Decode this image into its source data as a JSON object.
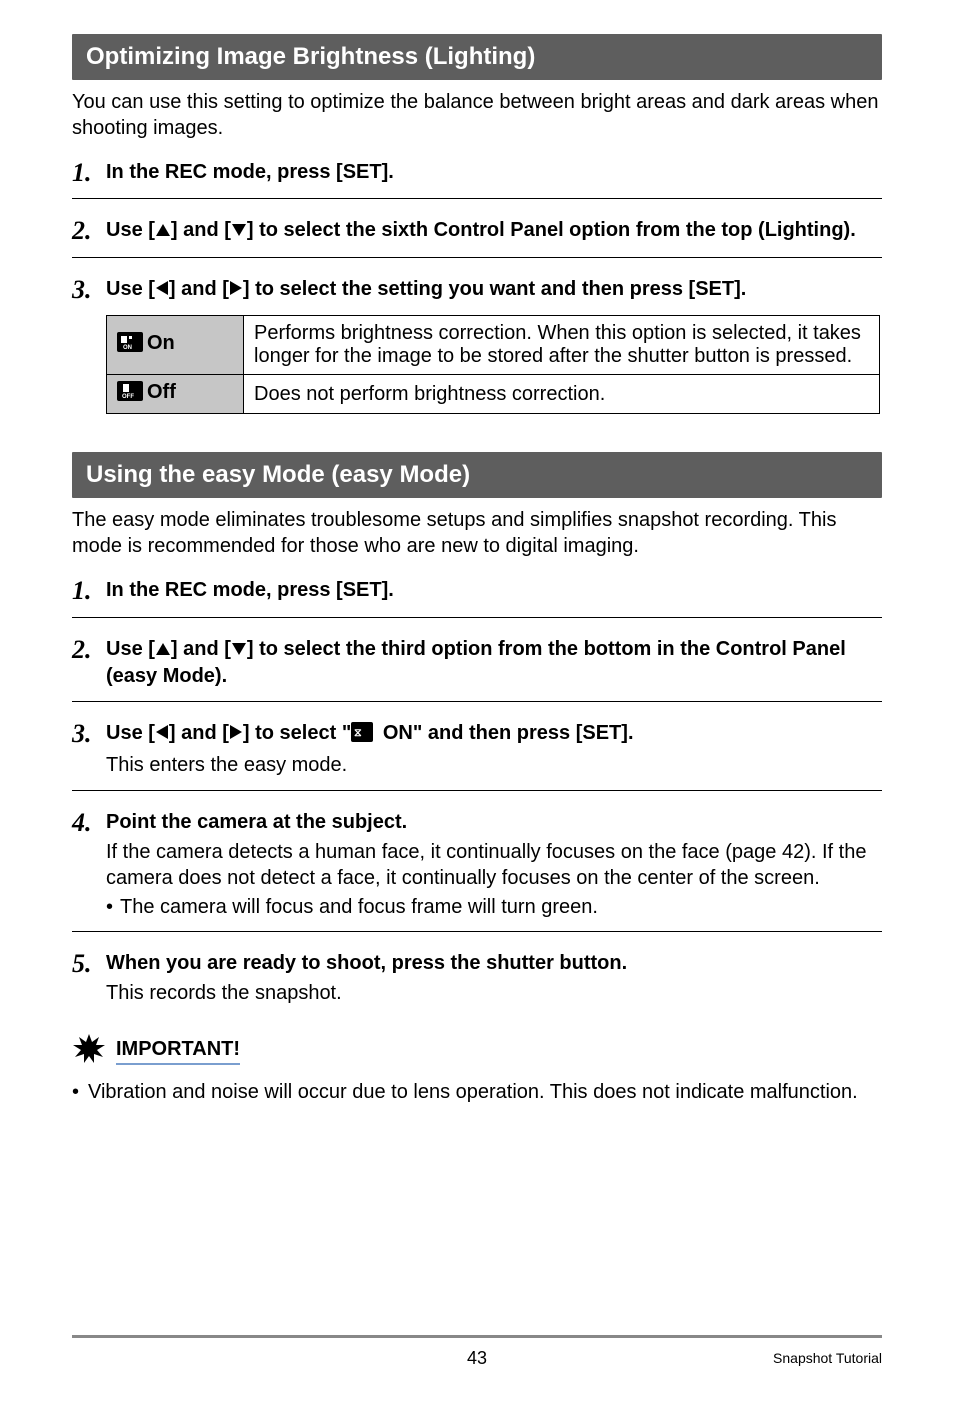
{
  "section1": {
    "title": "Optimizing Image Brightness (Lighting)",
    "intro": "You can use this setting to optimize the balance between bright areas and dark areas when shooting images.",
    "steps": {
      "s1": "In the REC mode, press [SET].",
      "s2a": "Use [",
      "s2b": "] and [",
      "s2c": "] to select the sixth Control Panel option from the top (Lighting).",
      "s3a": "Use [",
      "s3b": "] and [",
      "s3c": "] to select the setting you want and then press [SET]."
    },
    "table": {
      "on_label": "On",
      "on_desc": "Performs brightness correction. When this option is selected, it takes longer for the image to be stored after the shutter button is pressed.",
      "off_label": "Off",
      "off_desc": "Does not perform brightness correction."
    }
  },
  "section2": {
    "title": "Using the easy Mode (easy Mode)",
    "intro": "The easy mode eliminates troublesome setups and simplifies snapshot recording. This mode is recommended for those who are new to digital imaging.",
    "steps": {
      "s1": "In the REC mode, press [SET].",
      "s2a": "Use [",
      "s2b": "] and [",
      "s2c": "] to select the third option from the bottom in the Control Panel (easy Mode).",
      "s3a": "Use [",
      "s3b": "] and [",
      "s3c": "] to select \"",
      "s3d": " ON\" and then press [SET].",
      "s3_sub": "This enters the easy mode.",
      "s4_title": "Point the camera at the subject.",
      "s4_body": "If the camera detects a human face, it continually focuses on the face (page 42). If the camera does not detect a face, it continually focuses on the center of the screen.",
      "s4_bullet": "The camera will focus and focus frame will turn green.",
      "s5_title": "When you are ready to shoot, press the shutter button.",
      "s5_sub": "This records the snapshot."
    }
  },
  "important": {
    "label": "IMPORTANT!",
    "bullet": "Vibration and noise will occur due to lens operation. This does not indicate malfunction."
  },
  "footer": {
    "page": "43",
    "right": "Snapshot Tutorial"
  }
}
